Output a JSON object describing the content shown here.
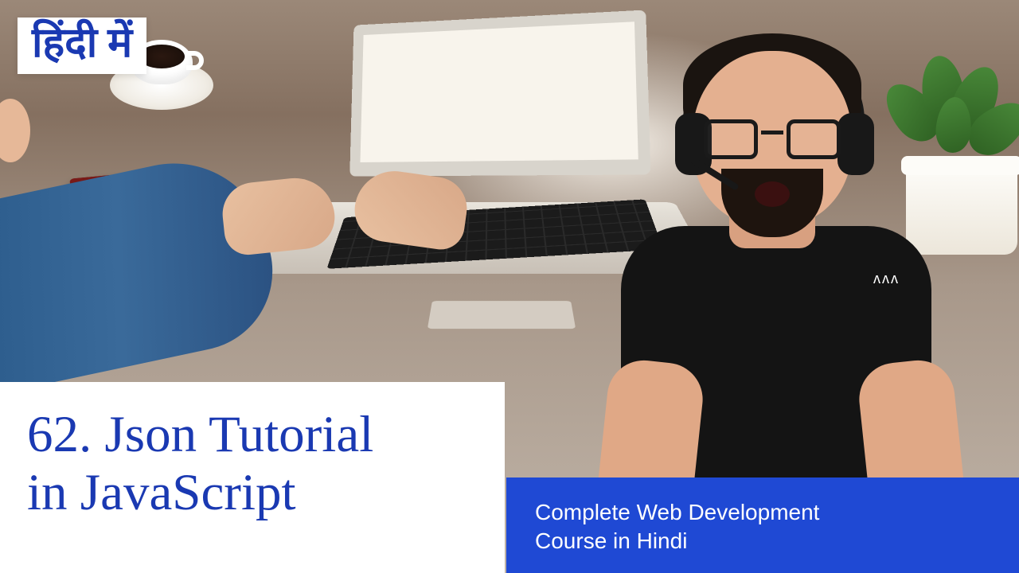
{
  "badge": {
    "text": "हिंदी में"
  },
  "title": {
    "line1": "62. Json Tutorial",
    "line2": "in JavaScript"
  },
  "subtitle": {
    "line1": "Complete Web Development",
    "line2": "Course in Hindi"
  },
  "presenter": {
    "shirt_logo": "ᴧᴧᴧ"
  },
  "colors": {
    "brand_blue_text": "#1a39b2",
    "brand_blue_bg": "#1f49d4",
    "white": "#ffffff"
  }
}
